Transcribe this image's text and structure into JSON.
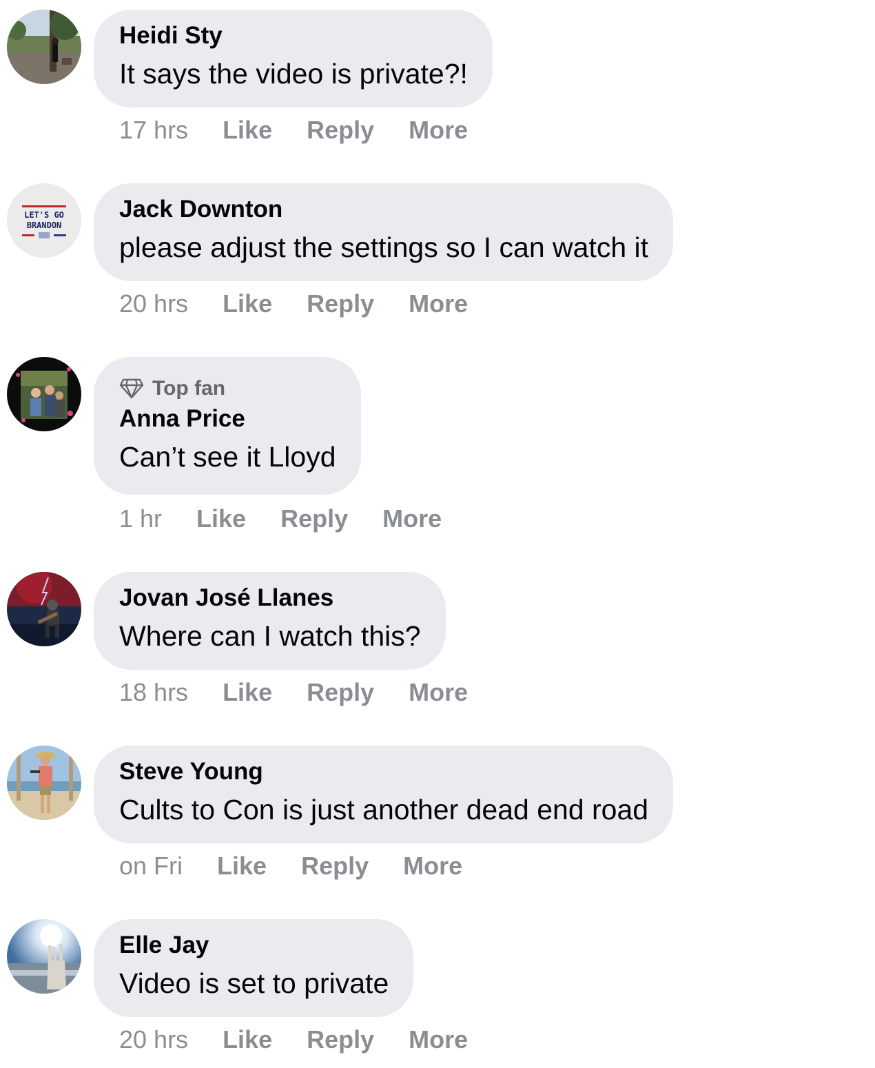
{
  "actions": {
    "like": "Like",
    "reply": "Reply",
    "more": "More"
  },
  "comments": [
    {
      "author": "Heidi Sty",
      "text": "It says the video is private?!",
      "time": "17 hrs",
      "avatar": "forest-photo"
    },
    {
      "author": "Jack Downton",
      "text": "please adjust the settings so I can watch it",
      "time": "20 hrs",
      "avatar": "lets-go-brandon-shirt",
      "avatar_text": [
        "LET'S GO",
        "BRANDON"
      ]
    },
    {
      "badge": "Top fan",
      "badge_icon": "diamond-icon",
      "author": "Anna Price",
      "text": "Can’t see it Lloyd",
      "time": "1 hr",
      "avatar": "family-photo"
    },
    {
      "author": "Jovan José Llanes",
      "text": "Where can I watch this?",
      "time": "18 hrs",
      "avatar": "guitarist-art"
    },
    {
      "author": "Steve Young",
      "text": "Cults to Con is just another dead end road",
      "time": "on Fri",
      "avatar": "beach-photo"
    },
    {
      "author": "Elle Jay",
      "text": "Video is set to private",
      "time": "20 hrs",
      "avatar": "sun-statue-photo"
    }
  ],
  "colors": {
    "bubble": "#eaebef",
    "meta_text": "#8a8d91",
    "author_text": "#050505"
  }
}
